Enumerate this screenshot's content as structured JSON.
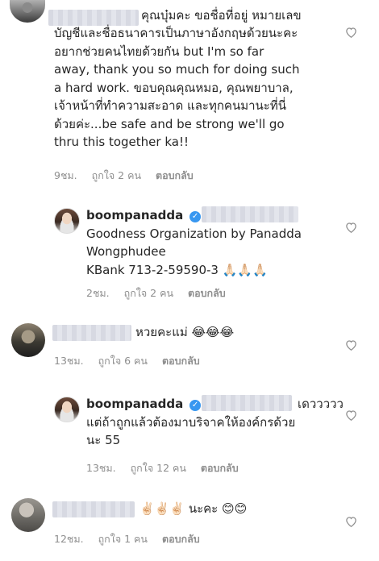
{
  "comments": [
    {
      "text": "คุณบุ๋มคะ ขอชื่อที่อยู่ หมายเลขบัญชีและชื่อธนาคารเป็นภาษาอังกฤษด้วยนะคะ อยากช่วยคนไทยด้วยกัน but I'm so far away, thank you so much for doing such a hard work. ขอบคุณคุณหมอ, คุณพยาบาล, เจ้าหน้าที่ทำความสะอาด และทุกคนมานะที่นี่ด้วยค่ะ...be safe and be strong we'll go thru this together ka!!",
      "lines": [
        "คุณบุ๋มคะ ขอชื่อที่อยู่ หมายเลข",
        "บัญชีและชื่อธนาคารเป็นภาษาอังกฤษด้วยนะคะ",
        "อยากช่วยคนไทยด้วยกัน but I'm so far",
        "away, thank you so much for doing such",
        "a hard work. ขอบคุณคุณหมอ, คุณพยาบาล,",
        "เจ้าหน้าที่ทำความสะอาด และทุกคนมานะที่นี่",
        "ด้วยค่ะ...be safe and be strong we'll go",
        "thru this together ka!!"
      ],
      "time": "9ชม.",
      "likes": "ถูกใจ 2 คน",
      "reply": "ตอบกลับ"
    },
    {
      "username": "boompanadda",
      "lines": [
        "Goodness Organization by Panadda",
        "Wongphudee",
        "KBank 713-2-59590-3"
      ],
      "emoji": "🙏🏻🙏🏻🙏🏻",
      "time": "2ชม.",
      "likes": "ถูกใจ 2 คน",
      "reply": "ตอบกลับ"
    },
    {
      "text": "หวยคะแม่",
      "emoji": "😂😂😂",
      "time": "13ชม.",
      "likes": "ถูกใจ 6 คน",
      "reply": "ตอบกลับ"
    },
    {
      "username": "boompanadda",
      "lines": [
        "เดววววว",
        "แต่ถ้าถูกแล้วต้องมาบริจาคให้องค์กรด้วย",
        "นะ 55"
      ],
      "time": "13ชม.",
      "likes": "ถูกใจ 12 คน",
      "reply": "ตอบกลับ"
    },
    {
      "text": "นะคะ",
      "emoji_before": "✌🏻✌🏻✌🏻",
      "emoji_after": "😊😊",
      "time": "12ชม.",
      "likes": "ถูกใจ 1 คน",
      "reply": "ตอบกลับ"
    }
  ],
  "icons": {
    "heart": "heart-icon",
    "verified": "verified-badge-icon"
  },
  "colors": {
    "meta": "#8e8e8e",
    "text": "#262626",
    "verified": "#3897f0"
  }
}
